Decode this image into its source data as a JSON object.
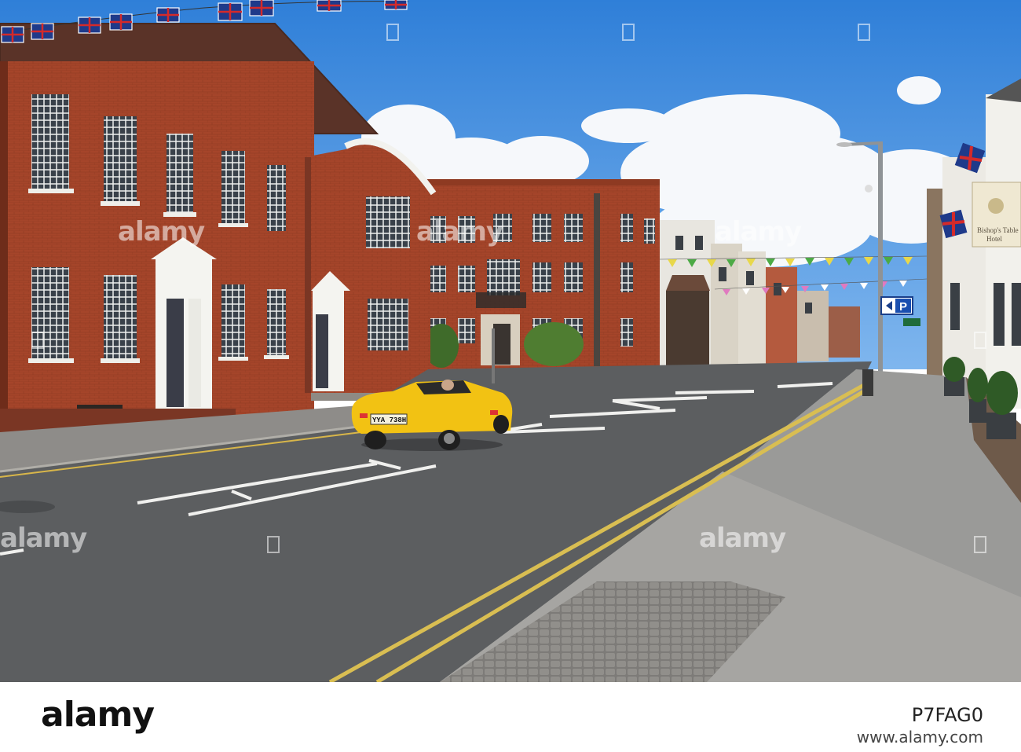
{
  "image": {
    "alt": "",
    "colors": {
      "sky": "#3d8de0",
      "brick": "#a5452a",
      "road": "#5c5e60",
      "car": "#f2c213",
      "pavement": "#9a9a98"
    }
  },
  "hotel_sign": {
    "line1": "Bishop's Table",
    "line2": "Hotel"
  },
  "car": {
    "plate": "YYA 738H"
  },
  "parking_sign": {
    "letter": "P"
  },
  "watermark": {
    "text": "alamy"
  },
  "footer": {
    "logo": "alamy",
    "image_id": "P7FAG0",
    "url": "www.alamy.com"
  }
}
